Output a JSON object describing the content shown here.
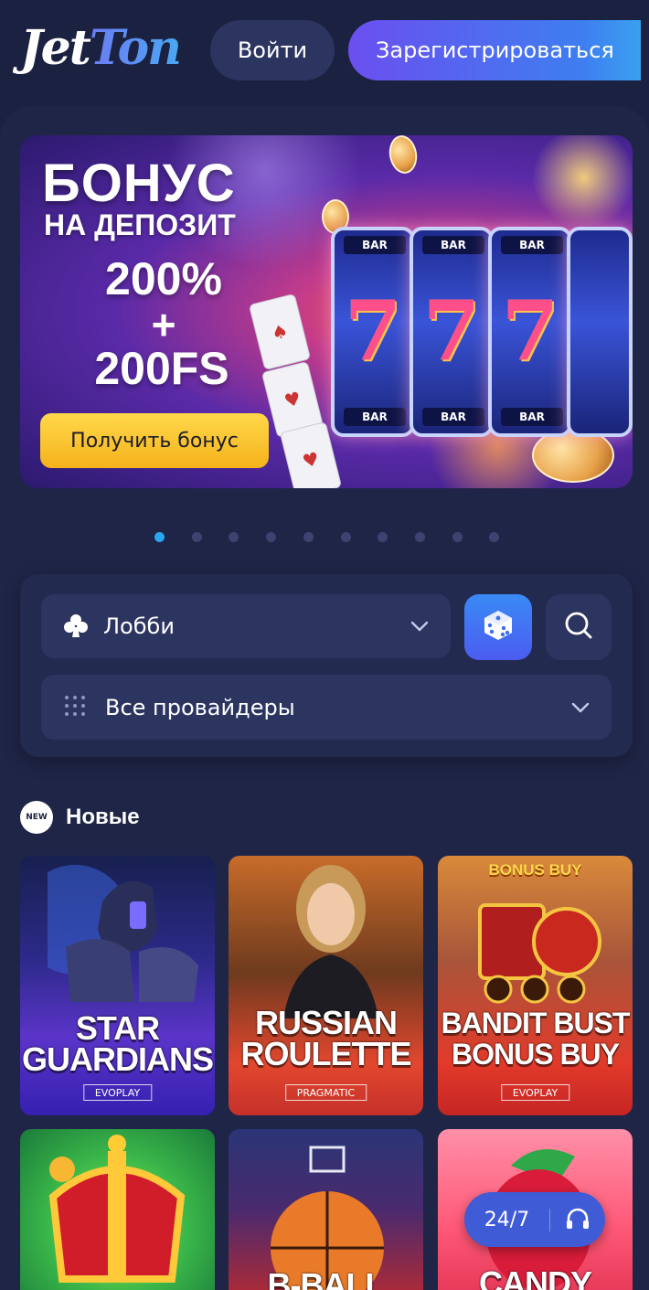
{
  "header": {
    "logo_part1": "Jet",
    "logo_part2": "Ton",
    "login_label": "Войти",
    "register_label": "Зарегистрироваться"
  },
  "banner": {
    "title": "БОНУС",
    "subtitle": "НА ДЕПОЗИТ",
    "percent": "200%",
    "plus": "+",
    "freespins": "200FS",
    "cta_label": "Получить бонус",
    "slot_symbol": "7",
    "slot_bar": "BAR"
  },
  "carousel": {
    "total": 10,
    "active_index": 0
  },
  "filters": {
    "lobby_label": "Лобби",
    "providers_label": "Все провайдеры"
  },
  "section": {
    "badge": "NEW",
    "title": "Новые"
  },
  "games": [
    {
      "name": "STAR GUARDIANS",
      "provider": "EVOPLAY",
      "tag": ""
    },
    {
      "name": "RUSSIAN ROULETTE",
      "provider": "PRAGMATIC",
      "tag": ""
    },
    {
      "name": "BANDIT BUST BONUS BUY",
      "provider": "EVOPLAY",
      "tag": "BONUS BUY"
    },
    {
      "name": "",
      "provider": "",
      "tag": ""
    },
    {
      "name": "B-BALL",
      "provider": "",
      "tag": ""
    },
    {
      "name": "CANDY",
      "provider": "",
      "tag": ""
    }
  ],
  "support": {
    "label": "24/7"
  },
  "colors": {
    "background": "#1b2140",
    "accent_blue": "#2aa6ee",
    "cta_yellow": "#f5b21b",
    "register_gradient_start": "#6b4ff0",
    "register_gradient_end": "#3aa0f0"
  }
}
